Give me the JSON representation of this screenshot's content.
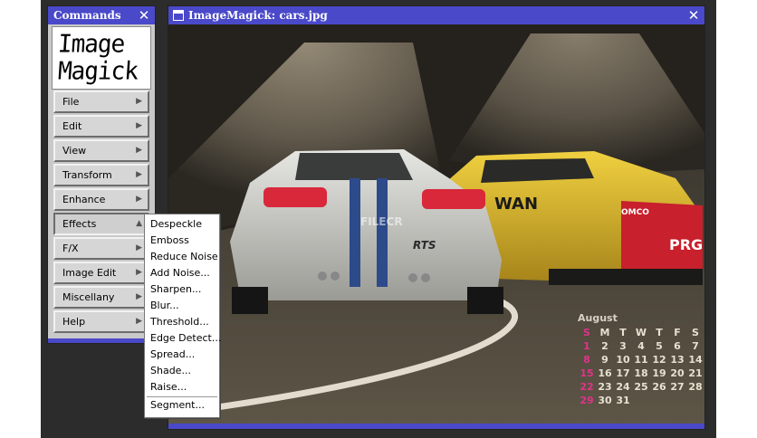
{
  "commands_window": {
    "title": "Commands",
    "close_glyph": "✕",
    "logo_line1": "Image",
    "logo_line2": "Magick",
    "menu": [
      {
        "label": "File"
      },
      {
        "label": "Edit"
      },
      {
        "label": "View"
      },
      {
        "label": "Transform"
      },
      {
        "label": "Enhance"
      },
      {
        "label": "Effects"
      },
      {
        "label": "F/X"
      },
      {
        "label": "Image Edit"
      },
      {
        "label": "Miscellany"
      },
      {
        "label": "Help"
      }
    ],
    "arrow_glyph": "▶",
    "open_arrow_glyph": "▲"
  },
  "effects_submenu": {
    "items": [
      "Despeckle",
      "Emboss",
      "Reduce Noise",
      "Add Noise...",
      "Sharpen...",
      "Blur...",
      "Threshold...",
      "Edge Detect...",
      "Spread...",
      "Shade...",
      "Raise...",
      "Segment..."
    ]
  },
  "image_window": {
    "title": "ImageMagick: cars.jpg",
    "close_glyph": "✕",
    "watermark": "FILECR",
    "car_plate": "RTS",
    "yellow_car_text1": "WAN",
    "yellow_car_text2": "OMCO",
    "yellow_car_text3": "PRG"
  },
  "calendar": {
    "month": "August",
    "weekdays": [
      "S",
      "M",
      "T",
      "W",
      "T",
      "F",
      "S"
    ],
    "weeks": [
      [
        "1",
        "2",
        "3",
        "4",
        "5",
        "6",
        "7"
      ],
      [
        "8",
        "9",
        "10",
        "11",
        "12",
        "13",
        "14"
      ],
      [
        "15",
        "16",
        "17",
        "18",
        "19",
        "20",
        "21"
      ],
      [
        "22",
        "23",
        "24",
        "25",
        "26",
        "27",
        "28"
      ],
      [
        "29",
        "30",
        "31",
        "",
        "",
        "",
        ""
      ]
    ]
  },
  "colors": {
    "titlebar": "#4a49c9",
    "sunday": "#e0338a"
  }
}
